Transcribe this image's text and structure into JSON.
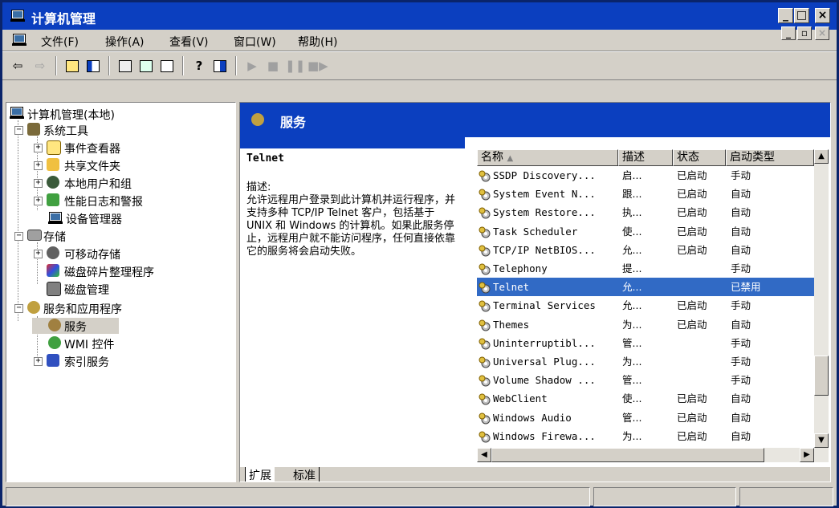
{
  "window": {
    "title": "计算机管理"
  },
  "menu": [
    "文件(F)",
    "操作(A)",
    "查看(V)",
    "窗口(W)",
    "帮助(H)"
  ],
  "tree": {
    "root": "计算机管理(本地)",
    "system_tools": "系统工具",
    "event_viewer": "事件查看器",
    "shared_folders": "共享文件夹",
    "local_users": "本地用户和组",
    "perf_logs": "性能日志和警报",
    "device_manager": "设备管理器",
    "storage": "存储",
    "removable": "可移动存储",
    "defrag": "磁盘碎片整理程序",
    "disk_mgmt": "磁盘管理",
    "services_apps": "服务和应用程序",
    "services": "服务",
    "wmi": "WMI 控件",
    "indexing": "索引服务"
  },
  "pane": {
    "title": "服务",
    "desc_name": "Telnet",
    "desc_label": "描述:",
    "desc_text": "允许远程用户登录到此计算机并运行程序，并支持多种 TCP/IP Telnet 客户，包括基于 UNIX 和 Windows 的计算机。如果此服务停止，远程用户就不能访问程序，任何直接依靠它的服务将会启动失败。"
  },
  "columns": {
    "name": "名称",
    "desc": "描述",
    "status": "状态",
    "startup": "启动类型"
  },
  "rows": [
    {
      "name": "SSDP Discovery...",
      "desc": "启...",
      "status": "已启动",
      "startup": "手动"
    },
    {
      "name": "System Event N...",
      "desc": "跟...",
      "status": "已启动",
      "startup": "自动"
    },
    {
      "name": "System Restore...",
      "desc": "执...",
      "status": "已启动",
      "startup": "自动"
    },
    {
      "name": "Task Scheduler",
      "desc": "使...",
      "status": "已启动",
      "startup": "自动"
    },
    {
      "name": "TCP/IP NetBIOS...",
      "desc": "允...",
      "status": "已启动",
      "startup": "自动"
    },
    {
      "name": "Telephony",
      "desc": "提...",
      "status": "",
      "startup": "手动"
    },
    {
      "name": "Telnet",
      "desc": "允...",
      "status": "",
      "startup": "已禁用"
    },
    {
      "name": "Terminal Services",
      "desc": "允...",
      "status": "已启动",
      "startup": "手动"
    },
    {
      "name": "Themes",
      "desc": "为...",
      "status": "已启动",
      "startup": "自动"
    },
    {
      "name": "Uninterruptibl...",
      "desc": "管...",
      "status": "",
      "startup": "手动"
    },
    {
      "name": "Universal Plug...",
      "desc": "为...",
      "status": "",
      "startup": "手动"
    },
    {
      "name": "Volume Shadow ...",
      "desc": "管...",
      "status": "",
      "startup": "手动"
    },
    {
      "name": "WebClient",
      "desc": "使...",
      "status": "已启动",
      "startup": "自动"
    },
    {
      "name": "Windows Audio",
      "desc": "管...",
      "status": "已启动",
      "startup": "自动"
    },
    {
      "name": "Windows Firewa...",
      "desc": "为...",
      "status": "已启动",
      "startup": "自动"
    }
  ],
  "tabs": {
    "extended": "扩展",
    "standard": "标准"
  },
  "colors": {
    "titlebar": "#0b3fbf",
    "selection": "#316ac5",
    "face": "#d4d0c8"
  }
}
